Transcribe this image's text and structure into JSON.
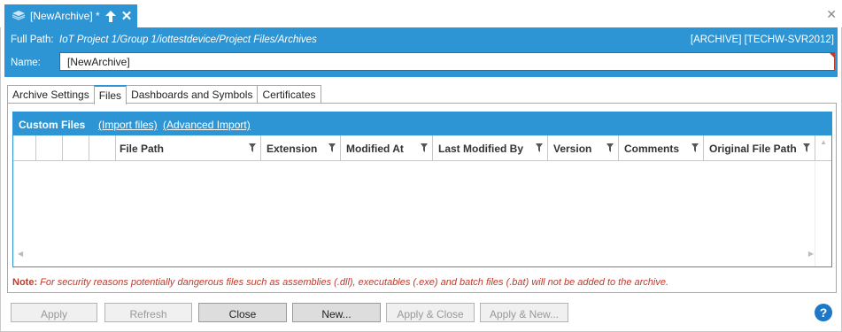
{
  "document_tab": {
    "title": "[NewArchive] *"
  },
  "header": {
    "full_path_label": "Full Path:",
    "full_path_value": "IoT Project 1/Group 1/iottestdevice/Project Files/Archives",
    "server": "[ARCHIVE] [TECHW-SVR2012]",
    "name_label": "Name:",
    "name_value": "[NewArchive]"
  },
  "tabs": [
    {
      "label": "Archive Settings"
    },
    {
      "label": "Files"
    },
    {
      "label": "Dashboards and Symbols"
    },
    {
      "label": "Certificates"
    }
  ],
  "custom_files": {
    "title": "Custom Files",
    "import_link": "(Import files)",
    "advanced_link": "(Advanced Import)",
    "columns": [
      {
        "label": "File Path"
      },
      {
        "label": "Extension"
      },
      {
        "label": "Modified At"
      },
      {
        "label": "Last Modified By"
      },
      {
        "label": "Version"
      },
      {
        "label": "Comments"
      },
      {
        "label": "Original File Path"
      }
    ],
    "rows": []
  },
  "note": {
    "label": "Note:",
    "text": "For security reasons potentially dangerous files such as assemblies (.dll), executables (.exe) and batch files (.bat) will not be added to the archive."
  },
  "buttons": {
    "apply": "Apply",
    "refresh": "Refresh",
    "close": "Close",
    "new": "New...",
    "apply_close": "Apply & Close",
    "apply_new": "Apply & New..."
  },
  "help": "?",
  "colors": {
    "accent": "#2d95d4",
    "warning": "#c0392b"
  },
  "icons": [
    "archive-icon",
    "pin-icon",
    "close-icon",
    "filter-icon",
    "help-icon"
  ]
}
